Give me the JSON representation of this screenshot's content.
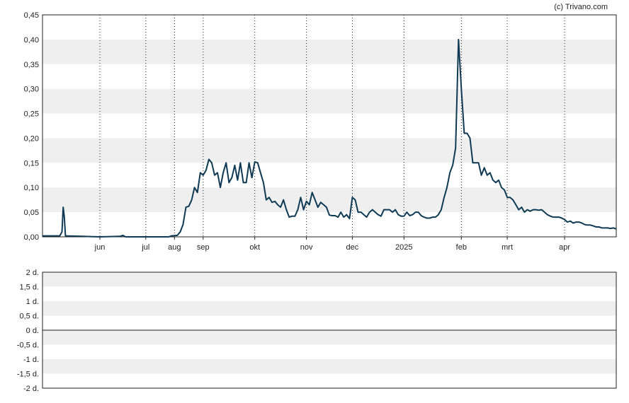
{
  "copyright": "(c) Trivano.com",
  "colors": {
    "line": "#0f3a55",
    "band": "#efefef",
    "grid": "#222222",
    "frame": "#222222",
    "text": "#222222"
  },
  "chart_data": [
    {
      "type": "line",
      "title": "",
      "xlabel": "",
      "ylabel": "",
      "ylim": [
        0,
        0.45
      ],
      "y_ticks": [
        "0,00",
        "0,05",
        "0,10",
        "0,15",
        "0,20",
        "0,25",
        "0,30",
        "0,35",
        "0,40",
        "0,45"
      ],
      "x_ticks": [
        "jun",
        "jul",
        "aug",
        "sep",
        "okt",
        "nov",
        "dec",
        "2025",
        "feb",
        "mrt",
        "apr"
      ],
      "x_tick_pos": [
        0.1,
        0.18,
        0.23,
        0.28,
        0.37,
        0.46,
        0.54,
        0.63,
        0.73,
        0.81,
        0.91
      ],
      "grid": "vertical dotted at month ticks, alternating horizontal bands",
      "series": [
        {
          "values": [
            [
              0.0,
              0.002
            ],
            [
              0.03,
              0.002
            ],
            [
              0.034,
              0.01
            ],
            [
              0.036,
              0.06
            ],
            [
              0.038,
              0.04
            ],
            [
              0.04,
              0.002
            ],
            [
              0.07,
              0.001
            ],
            [
              0.1,
              0.0
            ],
            [
              0.135,
              0.001
            ],
            [
              0.14,
              0.003
            ],
            [
              0.145,
              0.0
            ],
            [
              0.22,
              0.0
            ],
            [
              0.225,
              0.002
            ],
            [
              0.235,
              0.003
            ],
            [
              0.24,
              0.01
            ],
            [
              0.245,
              0.025
            ],
            [
              0.25,
              0.06
            ],
            [
              0.255,
              0.062
            ],
            [
              0.26,
              0.075
            ],
            [
              0.265,
              0.1
            ],
            [
              0.27,
              0.09
            ],
            [
              0.275,
              0.13
            ],
            [
              0.28,
              0.125
            ],
            [
              0.285,
              0.135
            ],
            [
              0.29,
              0.157
            ],
            [
              0.295,
              0.15
            ],
            [
              0.3,
              0.125
            ],
            [
              0.305,
              0.13
            ],
            [
              0.31,
              0.1
            ],
            [
              0.315,
              0.13
            ],
            [
              0.32,
              0.15
            ],
            [
              0.325,
              0.11
            ],
            [
              0.33,
              0.12
            ],
            [
              0.335,
              0.145
            ],
            [
              0.34,
              0.115
            ],
            [
              0.345,
              0.15
            ],
            [
              0.35,
              0.11
            ],
            [
              0.355,
              0.11
            ],
            [
              0.36,
              0.15
            ],
            [
              0.365,
              0.12
            ],
            [
              0.37,
              0.152
            ],
            [
              0.375,
              0.15
            ],
            [
              0.38,
              0.13
            ],
            [
              0.385,
              0.11
            ],
            [
              0.39,
              0.075
            ],
            [
              0.395,
              0.08
            ],
            [
              0.4,
              0.07
            ],
            [
              0.405,
              0.072
            ],
            [
              0.41,
              0.065
            ],
            [
              0.415,
              0.06
            ],
            [
              0.42,
              0.075
            ],
            [
              0.425,
              0.055
            ],
            [
              0.43,
              0.04
            ],
            [
              0.435,
              0.042
            ],
            [
              0.44,
              0.042
            ],
            [
              0.445,
              0.055
            ],
            [
              0.45,
              0.08
            ],
            [
              0.455,
              0.055
            ],
            [
              0.46,
              0.072
            ],
            [
              0.465,
              0.065
            ],
            [
              0.47,
              0.09
            ],
            [
              0.475,
              0.075
            ],
            [
              0.48,
              0.06
            ],
            [
              0.485,
              0.07
            ],
            [
              0.49,
              0.065
            ],
            [
              0.495,
              0.06
            ],
            [
              0.5,
              0.044
            ],
            [
              0.505,
              0.043
            ],
            [
              0.51,
              0.043
            ],
            [
              0.515,
              0.04
            ],
            [
              0.52,
              0.05
            ],
            [
              0.525,
              0.04
            ],
            [
              0.53,
              0.045
            ],
            [
              0.535,
              0.037
            ],
            [
              0.54,
              0.08
            ],
            [
              0.545,
              0.075
            ],
            [
              0.55,
              0.05
            ],
            [
              0.555,
              0.05
            ],
            [
              0.56,
              0.045
            ],
            [
              0.565,
              0.04
            ],
            [
              0.57,
              0.05
            ],
            [
              0.575,
              0.055
            ],
            [
              0.58,
              0.05
            ],
            [
              0.585,
              0.045
            ],
            [
              0.59,
              0.042
            ],
            [
              0.595,
              0.055
            ],
            [
              0.6,
              0.055
            ],
            [
              0.605,
              0.055
            ],
            [
              0.61,
              0.05
            ],
            [
              0.615,
              0.055
            ],
            [
              0.62,
              0.045
            ],
            [
              0.625,
              0.042
            ],
            [
              0.63,
              0.042
            ],
            [
              0.635,
              0.05
            ],
            [
              0.64,
              0.043
            ],
            [
              0.645,
              0.045
            ],
            [
              0.65,
              0.05
            ],
            [
              0.655,
              0.05
            ],
            [
              0.66,
              0.043
            ],
            [
              0.665,
              0.04
            ],
            [
              0.67,
              0.038
            ],
            [
              0.675,
              0.038
            ],
            [
              0.68,
              0.04
            ],
            [
              0.685,
              0.04
            ],
            [
              0.69,
              0.045
            ],
            [
              0.695,
              0.055
            ],
            [
              0.7,
              0.08
            ],
            [
              0.705,
              0.1
            ],
            [
              0.71,
              0.13
            ],
            [
              0.715,
              0.145
            ],
            [
              0.72,
              0.18
            ],
            [
              0.725,
              0.4
            ],
            [
              0.73,
              0.3
            ],
            [
              0.735,
              0.21
            ],
            [
              0.74,
              0.21
            ],
            [
              0.745,
              0.2
            ],
            [
              0.75,
              0.15
            ],
            [
              0.755,
              0.15
            ],
            [
              0.76,
              0.15
            ],
            [
              0.765,
              0.125
            ],
            [
              0.77,
              0.14
            ],
            [
              0.775,
              0.125
            ],
            [
              0.78,
              0.13
            ],
            [
              0.785,
              0.115
            ],
            [
              0.79,
              0.11
            ],
            [
              0.795,
              0.115
            ],
            [
              0.8,
              0.1
            ],
            [
              0.805,
              0.095
            ],
            [
              0.81,
              0.08
            ],
            [
              0.815,
              0.08
            ],
            [
              0.82,
              0.075
            ],
            [
              0.825,
              0.065
            ],
            [
              0.83,
              0.055
            ],
            [
              0.835,
              0.06
            ],
            [
              0.84,
              0.05
            ],
            [
              0.845,
              0.055
            ],
            [
              0.85,
              0.052
            ],
            [
              0.855,
              0.055
            ],
            [
              0.86,
              0.055
            ],
            [
              0.865,
              0.054
            ],
            [
              0.87,
              0.055
            ],
            [
              0.875,
              0.05
            ],
            [
              0.88,
              0.045
            ],
            [
              0.885,
              0.042
            ],
            [
              0.89,
              0.04
            ],
            [
              0.895,
              0.04
            ],
            [
              0.9,
              0.04
            ],
            [
              0.905,
              0.038
            ],
            [
              0.91,
              0.035
            ],
            [
              0.915,
              0.03
            ],
            [
              0.92,
              0.032
            ],
            [
              0.925,
              0.028
            ],
            [
              0.93,
              0.03
            ],
            [
              0.935,
              0.03
            ],
            [
              0.94,
              0.028
            ],
            [
              0.945,
              0.025
            ],
            [
              0.95,
              0.024
            ],
            [
              0.955,
              0.024
            ],
            [
              0.96,
              0.022
            ],
            [
              0.965,
              0.02
            ],
            [
              0.97,
              0.02
            ],
            [
              0.975,
              0.018
            ],
            [
              0.98,
              0.018
            ],
            [
              0.985,
              0.018
            ],
            [
              0.99,
              0.017
            ],
            [
              0.995,
              0.018
            ],
            [
              1.0,
              0.016
            ]
          ]
        }
      ]
    },
    {
      "type": "line",
      "title": "",
      "xlabel": "",
      "ylabel": "",
      "ylim": [
        -2,
        2
      ],
      "y_ticks": [
        "2 d.",
        "1,5 d.",
        "1 d.",
        "0,5 d.",
        "0 d.",
        "-0,5 d.",
        "-1 d.",
        "-1,5 d.",
        "-2 d."
      ],
      "zero_line": 0,
      "series": []
    }
  ]
}
